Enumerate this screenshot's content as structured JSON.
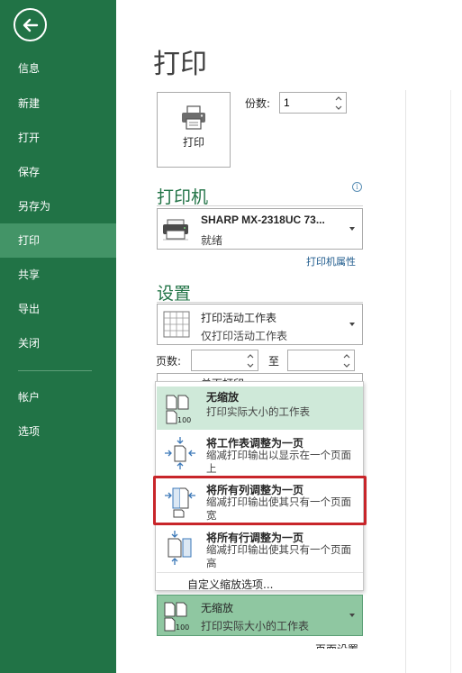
{
  "sidebar": {
    "items": [
      {
        "label": "信息"
      },
      {
        "label": "新建"
      },
      {
        "label": "打开"
      },
      {
        "label": "保存"
      },
      {
        "label": "另存为"
      },
      {
        "label": "打印",
        "active": true
      },
      {
        "label": "共享"
      },
      {
        "label": "导出"
      },
      {
        "label": "关闭"
      },
      {
        "label": "帐户"
      },
      {
        "label": "选项"
      }
    ],
    "color": "#217346",
    "active_color": "#439467"
  },
  "main": {
    "title": "打印",
    "print_button_label": "打印",
    "copies": {
      "label": "份数:",
      "value": "1"
    },
    "printer_section": {
      "heading": "打印机",
      "info_icon": "i",
      "selected_printer": {
        "name": "SHARP MX-2318UC 73...",
        "status": "就绪"
      },
      "properties_link": "打印机属性"
    },
    "settings_section": {
      "heading": "设置",
      "print_what": {
        "title": "打印活动工作表",
        "desc": "仅打印活动工作表"
      },
      "pages": {
        "label": "页数:",
        "to_label": "至",
        "from": "",
        "to": ""
      },
      "sides_peek": "单面打印"
    },
    "scaling_menu": {
      "items": [
        {
          "title": "无缩放",
          "desc": "打印实际大小的工作表",
          "icon": "no-scaling-icon",
          "selected": true
        },
        {
          "title": "将工作表调整为一页",
          "desc": "缩减打印输出以显示在一个页面上",
          "icon": "fit-sheet-icon"
        },
        {
          "title": "将所有列调整为一页",
          "desc": "缩减打印输出使其只有一个页面宽",
          "icon": "fit-columns-icon",
          "highlighted": true
        },
        {
          "title": "将所有行调整为一页",
          "desc": "缩减打印输出使其只有一个页面高",
          "icon": "fit-rows-icon"
        }
      ],
      "custom_option": "自定义缩放选项..."
    },
    "scaling_dropdown": {
      "title": "无缩放",
      "desc": "打印实际大小的工作表"
    },
    "page_setup_peek": "页面设置",
    "highlight_color": "#c8252a"
  }
}
